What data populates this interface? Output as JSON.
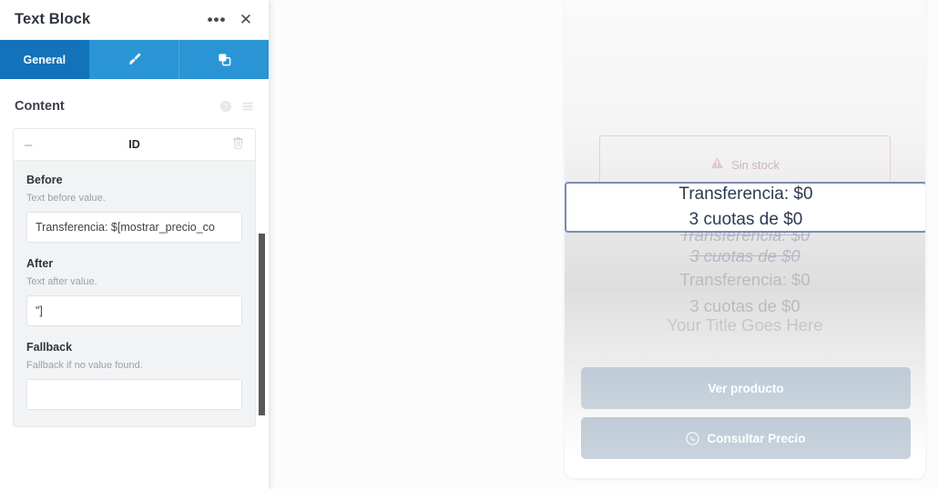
{
  "panel": {
    "title": "Text Block",
    "header_icons": [
      {
        "name": "more-options-icon",
        "glyph": "•••"
      },
      {
        "name": "close-icon",
        "glyph": "✕"
      }
    ],
    "tabs": [
      {
        "label": "General",
        "icon": "",
        "active": true
      },
      {
        "label": "",
        "icon": "paint-brush-icon",
        "active": false
      },
      {
        "label": "",
        "icon": "advanced-layers-icon",
        "active": false
      }
    ],
    "section": {
      "title": "Content",
      "tools": [
        {
          "name": "help-icon"
        },
        {
          "name": "list-view-icon"
        }
      ]
    },
    "repeater": {
      "collapse_glyph": "–",
      "name": "ID",
      "delete_icon": "trash-icon",
      "fields": [
        {
          "label": "Before",
          "description": "Text before value.",
          "value": "Transferencia: $[mostrar_precio_co",
          "placeholder": ""
        },
        {
          "label": "After",
          "description": "Text after value.",
          "value": "\"]",
          "placeholder": ""
        },
        {
          "label": "Fallback",
          "description": "Fallback if no value found.",
          "value": "",
          "placeholder": ""
        }
      ]
    }
  },
  "preview": {
    "stock_badge": {
      "icon": "warning-triangle-icon",
      "text": "Sin stock"
    },
    "selected_block": {
      "line1": "Transferencia: $0",
      "line2": "3 cuotas de $0",
      "border_color": "#7b8ab3"
    },
    "faded_lines": [
      {
        "text": "Transferencia: $0",
        "strikethrough": true
      },
      {
        "text": "3 cuotas de $0",
        "strikethrough": true
      },
      {
        "text": "Transferencia: $0",
        "strikethrough": false
      },
      {
        "text": "3 cuotas de $0",
        "strikethrough": false
      },
      {
        "text": "Your Title Goes Here",
        "strikethrough": false
      }
    ],
    "buttons": [
      {
        "label": "Ver producto",
        "icon": ""
      },
      {
        "label": "Consultar Precio",
        "icon": "whatsapp-icon"
      }
    ]
  },
  "colors": {
    "tab_active": "#1273ba",
    "tab_inactive": "#2a95d5",
    "selection_border": "#7b8ab3",
    "cta_bg": "#c3cfd9"
  }
}
